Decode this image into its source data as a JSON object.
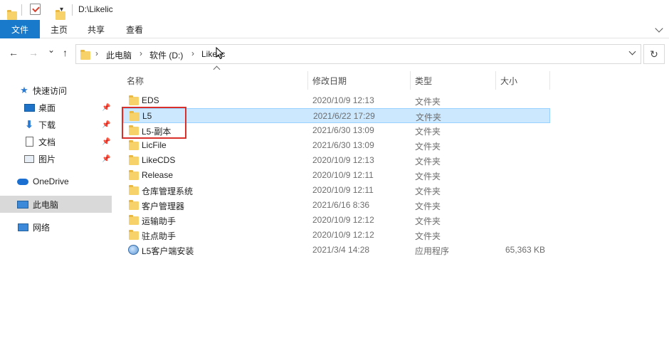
{
  "window": {
    "title_path": "D:\\Likelic"
  },
  "quick_access": {
    "icons": [
      "folder-icon",
      "properties-check-icon",
      "new-folder-icon",
      "customize-dropdown-icon"
    ]
  },
  "ribbon": {
    "tabs": [
      {
        "label": "文件",
        "active": true
      },
      {
        "label": "主页"
      },
      {
        "label": "共享"
      },
      {
        "label": "查看"
      }
    ],
    "accent_color": "#1979ca"
  },
  "nav": {
    "back": "←",
    "forward": "→",
    "recent": "⌄",
    "up": "↑",
    "refresh": "↻",
    "breadcrumbs": [
      "此电脑",
      "软件 (D:)",
      "Likelic"
    ],
    "separator": "›"
  },
  "sidebar": {
    "items": [
      {
        "label": "快速访问",
        "icon": "star-icon"
      },
      {
        "label": "桌面",
        "icon": "desktop-icon",
        "pinned": true
      },
      {
        "label": "下载",
        "icon": "download-icon",
        "pinned": true
      },
      {
        "label": "文档",
        "icon": "document-icon",
        "pinned": true
      },
      {
        "label": "图片",
        "icon": "pictures-icon",
        "pinned": true
      },
      {
        "label": "OneDrive",
        "icon": "cloud-icon"
      },
      {
        "label": "此电脑",
        "icon": "computer-icon",
        "active": true
      },
      {
        "label": "网络",
        "icon": "network-icon"
      }
    ],
    "pin_glyph": "📌"
  },
  "columns": [
    "名称",
    "修改日期",
    "类型",
    "大小"
  ],
  "files": [
    {
      "name": "EDS",
      "date": "2020/10/9 12:13",
      "type": "文件夹",
      "size": "",
      "icon": "folder-icon"
    },
    {
      "name": "L5",
      "date": "2021/6/22 17:29",
      "type": "文件夹",
      "size": "",
      "icon": "folder-icon",
      "selected": true
    },
    {
      "name": "L5-副本",
      "date": "2021/6/30 13:09",
      "type": "文件夹",
      "size": "",
      "icon": "folder-icon"
    },
    {
      "name": "LicFile",
      "date": "2021/6/30 13:09",
      "type": "文件夹",
      "size": "",
      "icon": "folder-icon"
    },
    {
      "name": "LikeCDS",
      "date": "2020/10/9 12:13",
      "type": "文件夹",
      "size": "",
      "icon": "folder-icon"
    },
    {
      "name": "Release",
      "date": "2020/10/9 12:11",
      "type": "文件夹",
      "size": "",
      "icon": "folder-icon"
    },
    {
      "name": "仓库管理系统",
      "date": "2020/10/9 12:11",
      "type": "文件夹",
      "size": "",
      "icon": "folder-icon"
    },
    {
      "name": "客户管理器",
      "date": "2021/6/16 8:36",
      "type": "文件夹",
      "size": "",
      "icon": "folder-icon"
    },
    {
      "name": "运输助手",
      "date": "2020/10/9 12:12",
      "type": "文件夹",
      "size": "",
      "icon": "folder-icon"
    },
    {
      "name": "驻点助手",
      "date": "2020/10/9 12:12",
      "type": "文件夹",
      "size": "",
      "icon": "folder-icon"
    },
    {
      "name": "L5客户端安装",
      "date": "2021/3/4 14:28",
      "type": "应用程序",
      "size": "65,363 KB",
      "icon": "installer-icon"
    }
  ],
  "colors": {
    "selection_bg": "#cce8ff",
    "selection_border": "#99d1ff",
    "annotation_red": "#d9302c",
    "folder_yellow": "#f7d26b"
  }
}
